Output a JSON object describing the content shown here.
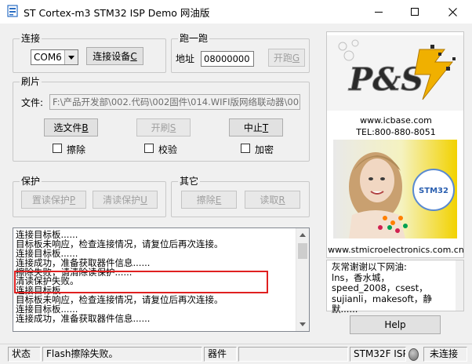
{
  "window": {
    "title": "ST Cortex-m3 STM32  ISP Demo 网油版",
    "controls": {
      "minimize": "minimize",
      "maximize": "maximize",
      "close": "close"
    }
  },
  "connect": {
    "group_title": "连接",
    "port_value": "COM6",
    "connect_button": "连接设备",
    "connect_button_key": "C"
  },
  "run": {
    "group_title": "跑一跑",
    "address_label": "地址",
    "address_value": "08000000",
    "run_button": "开跑",
    "run_button_key": "G"
  },
  "flash": {
    "group_title": "刷片",
    "file_label": "文件:",
    "file_path": "F:\\产品开发部\\002.代码\\002固件\\014.WIFI版网络联动器\\00",
    "select_file_button": "选文件",
    "select_file_key": "B",
    "start_flash_button": "开刷",
    "start_flash_key": "S",
    "abort_button": "中止",
    "abort_key": "T",
    "erase_label": "擦除",
    "verify_label": "校验",
    "encrypt_label": "加密"
  },
  "protect": {
    "group_title": "保护",
    "set_read_protect": "置读保护",
    "set_read_protect_key": "P",
    "clear_read_protect": "清读保护",
    "clear_read_protect_key": "U"
  },
  "other": {
    "group_title": "其它",
    "erase_button": "擦除",
    "erase_key": "E",
    "read_button": "读取",
    "read_key": "R"
  },
  "log": {
    "lines": [
      "连接目标板......",
      "目标板未响应，检查连接情况，请复位后再次连接。",
      "连接目标板......",
      "连接成功，准备获取器件信息......",
      "擦除失败，请清除读保护......",
      "清读保护失败。",
      "连接目标板......",
      "目标板未响应，检查连接情况，请复位后再次连接。",
      "连接目标板......",
      "连接成功，准备获取器件信息......"
    ]
  },
  "ad": {
    "logo_text": "P&S",
    "website": "www.icbase.com",
    "tel": "TEL:800-880-8051",
    "product_badge": "STM32",
    "st_website": "www.stmicroelectronics.com.cn"
  },
  "thanks": {
    "text": "灰常谢谢以下网油:\nlns，香水城，speed_2008，csest，sujianli，makesoft，静默......"
  },
  "help_button": "Help",
  "statusbar": {
    "status_label": "状态",
    "status_message": "Flash擦除失败。",
    "device_label": "器件",
    "device_value": "",
    "isp_label": "STM32F ISP",
    "connection_state": "未连接"
  }
}
